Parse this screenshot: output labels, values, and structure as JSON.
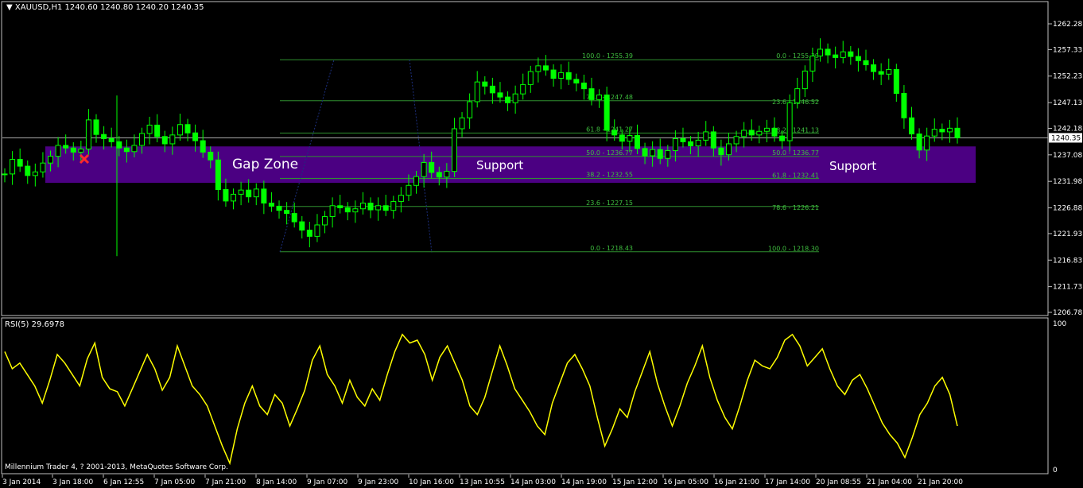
{
  "chart_data": [
    {
      "type": "line",
      "symbol_header": "XAUUSD,H1",
      "ohlc_header": "1240.60 1240.80 1240.20 1240.35",
      "current_price_label": "1240.35",
      "current_price": 1240.35,
      "ylim": [
        1206.78,
        1262.28
      ],
      "y_ticks": [
        "1262.28",
        "1257.33",
        "1252.23",
        "1247.13",
        "1242.18",
        "1237.08",
        "1231.98",
        "1226.88",
        "1221.93",
        "1216.83",
        "1211.73",
        "1206.78"
      ],
      "x_ticks": [
        "3 Jan 2014",
        "3 Jan 18:00",
        "6 Jan 12:55",
        "7 Jan 05:00",
        "7 Jan 21:00",
        "8 Jan 14:00",
        "9 Jan 07:00",
        "9 Jan 23:00",
        "10 Jan 16:00",
        "13 Jan 10:55",
        "14 Jan 03:00",
        "14 Jan 19:00",
        "15 Jan 12:00",
        "16 Jan 05:00",
        "16 Jan 21:00",
        "17 Jan 14:00",
        "20 Jan 08:55",
        "21 Jan 04:00",
        "21 Jan 20:00"
      ],
      "price_series": [
        1233.4,
        1236.2,
        1234.9,
        1233.1,
        1233.8,
        1235.5,
        1236.8,
        1238.9,
        1238.4,
        1237.6,
        1238.2,
        1243.8,
        1241.0,
        1240.2,
        1239.6,
        1238.4,
        1237.7,
        1238.9,
        1241.2,
        1242.8,
        1240.6,
        1239.2,
        1240.9,
        1242.9,
        1241.3,
        1239.8,
        1237.6,
        1236.1,
        1230.4,
        1228.2,
        1229.5,
        1230.3,
        1229.0,
        1230.5,
        1227.8,
        1227.2,
        1226.4,
        1225.8,
        1224.2,
        1222.6,
        1221.4,
        1223.6,
        1225.2,
        1227.3,
        1226.9,
        1226.1,
        1226.7,
        1227.8,
        1226.5,
        1227.3,
        1226.4,
        1228.1,
        1229.3,
        1231.2,
        1232.9,
        1235.6,
        1233.7,
        1232.8,
        1233.9,
        1242.1,
        1244.2,
        1247.3,
        1251.1,
        1250.3,
        1249.0,
        1248.2,
        1247.1,
        1248.8,
        1250.6,
        1253.1,
        1254.2,
        1253.4,
        1251.8,
        1252.9,
        1251.6,
        1250.9,
        1249.8,
        1247.7,
        1248.6,
        1241.8,
        1240.9,
        1239.7,
        1240.8,
        1238.3,
        1236.9,
        1238.1,
        1236.4,
        1237.9,
        1240.2,
        1239.6,
        1238.8,
        1239.9,
        1241.5,
        1238.4,
        1237.1,
        1239.2,
        1240.6,
        1241.8,
        1240.9,
        1241.6,
        1242.2,
        1240.7,
        1239.8,
        1247.1,
        1249.8,
        1253.2,
        1256.1,
        1257.4,
        1256.3,
        1255.8,
        1256.9,
        1256.0,
        1255.2,
        1254.4,
        1253.1,
        1252.6,
        1253.5,
        1248.9,
        1244.2,
        1241.1,
        1238.0,
        1240.7,
        1242.0,
        1241.5,
        1242.2,
        1240.35
      ],
      "overlays": {
        "gap_zone_label": "Gap Zone",
        "support_labels": [
          "Support",
          "Support"
        ],
        "zone_color": "#4b0082",
        "fib_set_1": [
          {
            "ratio": "100.0",
            "price": 1255.39,
            "text": "100.0 - 1255.39"
          },
          {
            "ratio": "78.6",
            "price": 1247.48,
            "text": "78.6 - 1247.48"
          },
          {
            "ratio": "61.8",
            "price": 1241.27,
            "text": "61.8 - 1241.27"
          },
          {
            "ratio": "50.0",
            "price": 1236.77,
            "text": "50.0 - 1236.77"
          },
          {
            "ratio": "38.2",
            "price": 1232.55,
            "text": "38.2 - 1232.55"
          },
          {
            "ratio": "23.6",
            "price": 1227.15,
            "text": "23.6 - 1227.15"
          },
          {
            "ratio": "0.0",
            "price": 1218.43,
            "text": "0.0 - 1218.43"
          }
        ],
        "fib_set_2": [
          {
            "ratio": "0.0",
            "price": 1255.39,
            "text": "0.0 - 1255.39"
          },
          {
            "ratio": "23.6",
            "price": 1246.52,
            "text": "23.6 - 1246.52"
          },
          {
            "ratio": "38.2",
            "price": 1241.13,
            "text": "38.2 - 1241.13"
          },
          {
            "ratio": "50.0",
            "price": 1236.77,
            "text": "50.0 - 1236.77"
          },
          {
            "ratio": "61.8",
            "price": 1232.41,
            "text": "61.8 - 1232.41"
          },
          {
            "ratio": "78.6",
            "price": 1226.21,
            "text": "78.6 - 1226.21"
          },
          {
            "ratio": "100.0",
            "price": 1218.3,
            "text": "100.0 - 1218.30"
          }
        ],
        "fib_line_color": "#2f8f2f",
        "fib_text_color": "#3fbf3f",
        "candle_color": "#00ff00",
        "marker": "red-x"
      }
    },
    {
      "type": "line",
      "indicator_header": "RSI(5) 29.6978",
      "ylim": [
        0,
        100
      ],
      "y_ticks": [
        "100",
        "0"
      ],
      "line_color": "#ffff00",
      "rsi_series": [
        82,
        70,
        74,
        66,
        58,
        46,
        62,
        80,
        74,
        66,
        58,
        77,
        88,
        64,
        56,
        54,
        44,
        56,
        68,
        80,
        70,
        55,
        64,
        86,
        72,
        58,
        52,
        44,
        30,
        16,
        4,
        28,
        46,
        58,
        44,
        38,
        52,
        46,
        30,
        42,
        55,
        76,
        86,
        66,
        58,
        46,
        62,
        50,
        44,
        56,
        48,
        66,
        82,
        94,
        88,
        90,
        80,
        62,
        78,
        86,
        74,
        62,
        44,
        38,
        50,
        68,
        86,
        72,
        56,
        48,
        40,
        30,
        24,
        46,
        60,
        74,
        80,
        70,
        58,
        36,
        16,
        28,
        42,
        36,
        54,
        68,
        82,
        60,
        44,
        30,
        44,
        60,
        72,
        86,
        64,
        48,
        36,
        28,
        44,
        62,
        76,
        72,
        70,
        78,
        90,
        94,
        86,
        72,
        78,
        84,
        70,
        58,
        52,
        62,
        66,
        56,
        44,
        32,
        24,
        18,
        8,
        22,
        38,
        46,
        58,
        64,
        52,
        30
      ]
    }
  ],
  "footer": {
    "copyright": "Millennium Trader 4, ? 2001-2013, MetaQuotes Software Corp."
  }
}
